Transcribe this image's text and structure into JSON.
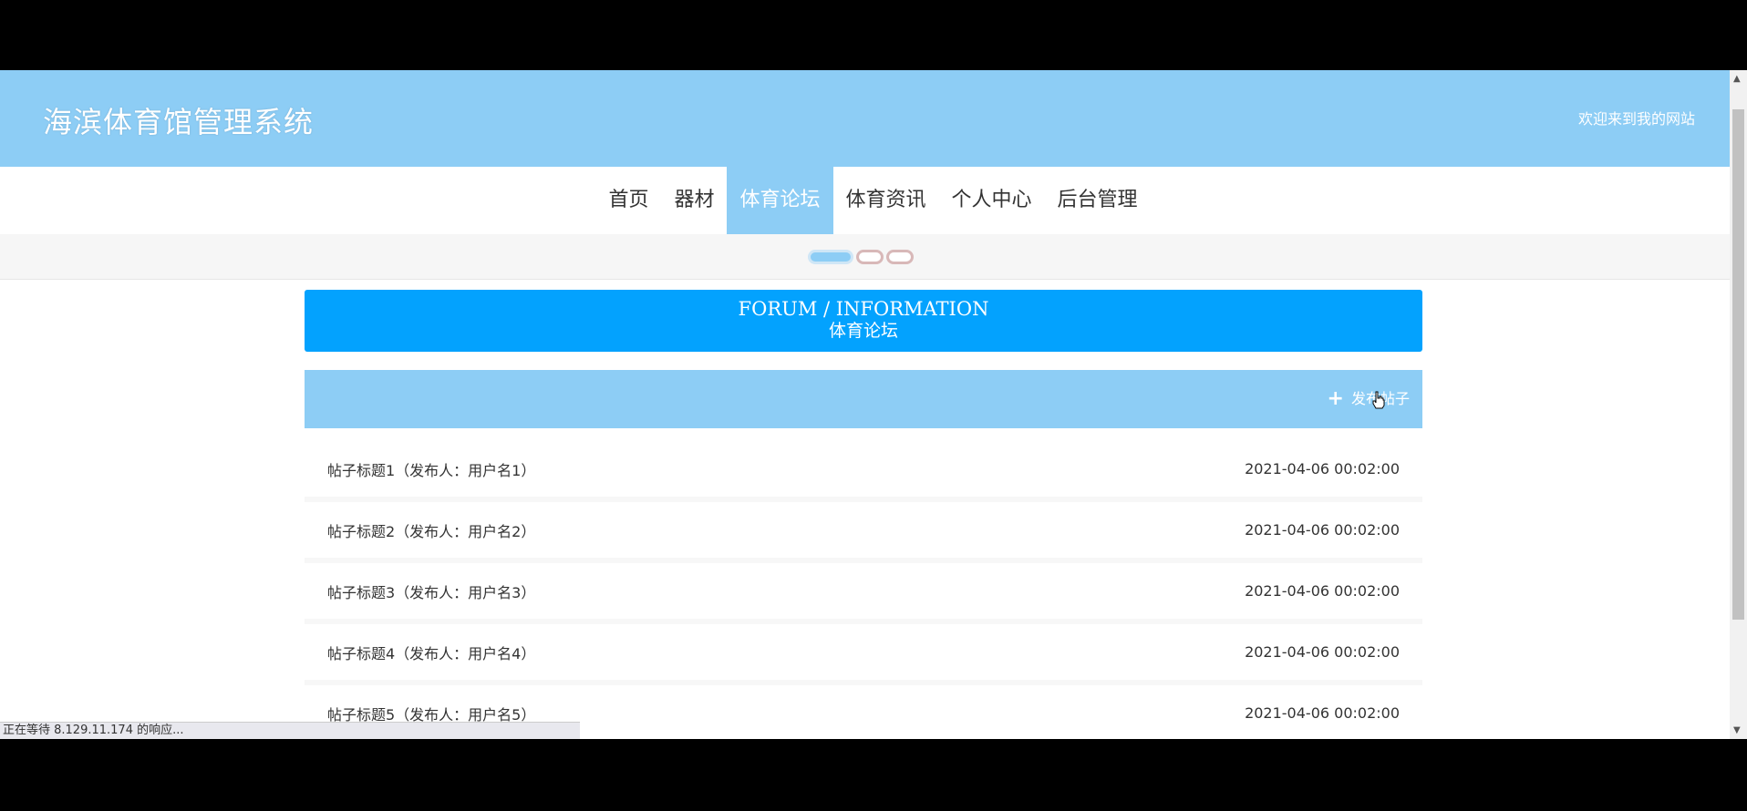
{
  "header": {
    "site_title": "海滨体育馆管理系统",
    "welcome": "欢迎来到我的网站"
  },
  "nav": {
    "items": [
      "首页",
      "器材",
      "体育论坛",
      "体育资讯",
      "个人中心",
      "后台管理"
    ],
    "active": "体育论坛"
  },
  "section": {
    "title_en": "FORUM / INFORMATION",
    "title_cn": "体育论坛"
  },
  "toolbar": {
    "post_button_label": "发布帖子",
    "post_button_icon": "plus-icon"
  },
  "posts": [
    {
      "title": "帖子标题1（发布人：用户名1）",
      "time": "2021-04-06 00:02:00"
    },
    {
      "title": "帖子标题2（发布人：用户名2）",
      "time": "2021-04-06 00:02:00"
    },
    {
      "title": "帖子标题3（发布人：用户名3）",
      "time": "2021-04-06 00:02:00"
    },
    {
      "title": "帖子标题4（发布人：用户名4）",
      "time": "2021-04-06 00:02:00"
    },
    {
      "title": "帖子标题5（发布人：用户名5）",
      "time": "2021-04-06 00:02:00"
    }
  ],
  "status_bar": "正在等待 8.129.11.174 的响应...",
  "colors": {
    "header_bg": "#8dcdf5",
    "section_head_bg": "#03a2fe",
    "active_nav_bg": "#8dcdf5"
  }
}
